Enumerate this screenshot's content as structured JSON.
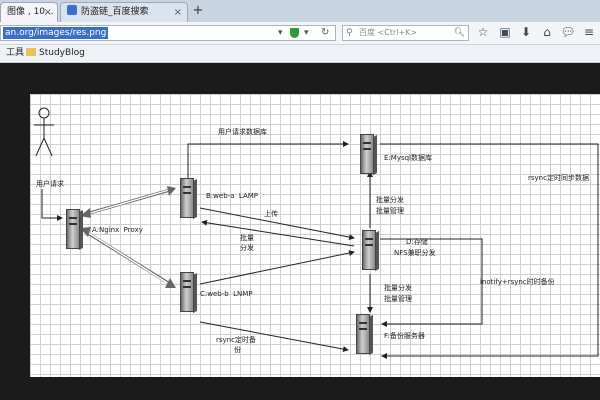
{
  "tabs": [
    {
      "label": "图像 , 10...",
      "active": true
    },
    {
      "label": "防盗链_百度搜索",
      "active": false
    }
  ],
  "toolbar": {
    "url": "an.org/images/res.png",
    "search_placeholder": "百度 <Ctrl+K>"
  },
  "bookmarks": [
    {
      "label": "工具"
    },
    {
      "label": "StudyBlog"
    }
  ],
  "diagram": {
    "user": "用户请求",
    "proxy": "A:Nginx  Proxy",
    "web_a": "B:web-a  LAMP",
    "web_b": "C:web-b  LNMP",
    "mysql": "E:Mysql数据库",
    "storage_line1": "D:存储",
    "storage_line2": "NFS兼职分发",
    "backup": "F:备份服务器",
    "edge_user_db": "用户请求数据库",
    "edge_upload": "上传",
    "edge_batch_dist1": "批量",
    "edge_batch_dist2": "分发",
    "edge_batch_mgmt_top1": "批量分发",
    "edge_batch_mgmt_top2": "批量管理",
    "edge_batch_mgmt_bottom1": "批量分发",
    "edge_batch_mgmt_bottom2": "批量管理",
    "edge_rsync_backup1": "rsync定时备",
    "edge_rsync_backup2": "份",
    "edge_rsync_sync": "rsync定时同步数据",
    "edge_inotify": "inotify+rsync时时备份"
  },
  "colors": {
    "tab_strip": "#c9d4e2",
    "url_highlight": "#3a6fc8",
    "shield": "#2d9b3b",
    "page_background": "#1b1b1b",
    "grid_line": "#cfcfcf"
  },
  "icons": [
    "search-icon",
    "shield-icon",
    "reload-icon",
    "star-icon",
    "clipboard-icon",
    "download-icon",
    "home-icon",
    "chat-icon",
    "menu-icon"
  ]
}
